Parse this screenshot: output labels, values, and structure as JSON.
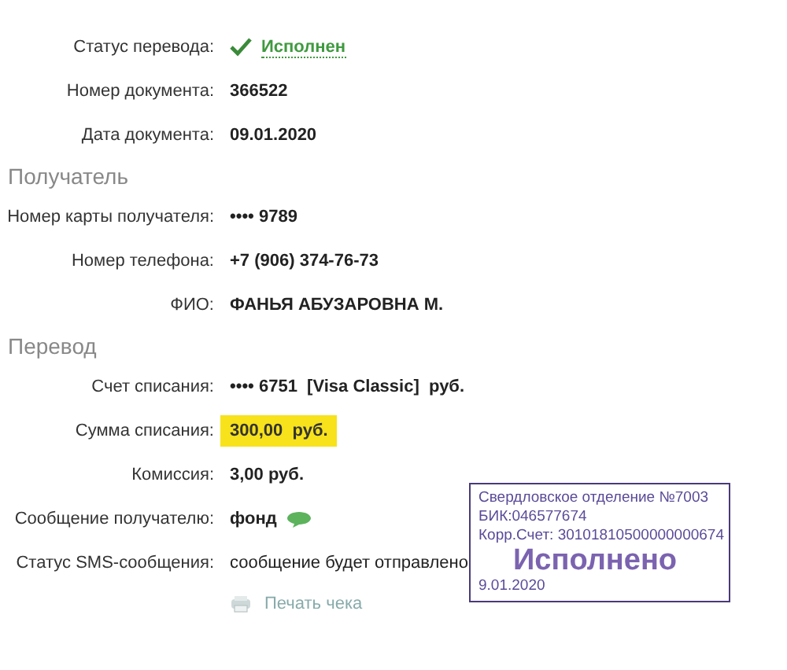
{
  "rows": [
    {
      "label": "Статус перевода:",
      "value": "Исполнен",
      "kind": "status"
    },
    {
      "label": "Номер документа:",
      "value": "366522",
      "kind": "bold"
    },
    {
      "label": "Дата документа:",
      "value": "09.01.2020",
      "kind": "bold"
    }
  ],
  "sections": [
    {
      "title": "Получатель",
      "rows": [
        {
          "label": "Номер карты получателя:",
          "value": "•••• 9789",
          "kind": "bold"
        },
        {
          "label": "Номер телефона:",
          "value": "+7 (906) 374-76-73",
          "kind": "bold"
        },
        {
          "label": "ФИО:",
          "value": "ФАНЬЯ АБУЗАРОВНА М.",
          "kind": "bold"
        }
      ]
    },
    {
      "title": "Перевод",
      "rows": [
        {
          "label": "Счет списания:",
          "value": "•••• 6751  [Visa Classic]  руб.",
          "kind": "bold"
        },
        {
          "label": "Сумма списания:",
          "value": "300,00  руб.",
          "kind": "highlight"
        },
        {
          "label": "Комиссия:",
          "value": "3,00 руб.",
          "kind": "bold"
        },
        {
          "label": "Сообщение получателю:",
          "value": "фонд",
          "kind": "message"
        },
        {
          "label": "Статус SMS-сообщения:",
          "value": "сообщение будет отправлено",
          "kind": "plain"
        }
      ]
    }
  ],
  "print_link": "Печать чека",
  "stamp": {
    "lines": [
      "Свердловское отделение №7003",
      "БИК:046577674",
      "Корр.Счет: 30101810500000000674"
    ],
    "status": "Исполнено",
    "date": "9.01.2020"
  }
}
